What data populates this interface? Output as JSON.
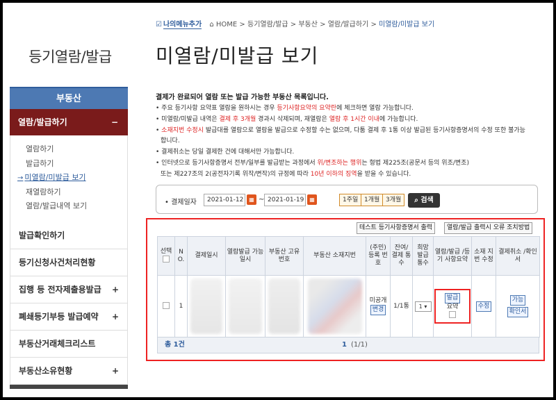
{
  "sidebar": {
    "title": "등기열람/발급",
    "section": "부동산",
    "active": "열람/발급하기",
    "sub_items": [
      "열람하기",
      "발급하기",
      "미열람/미발급 보기",
      "재열람하기",
      "열람/발급내역 보기"
    ],
    "menus": [
      {
        "label": "발급확인하기",
        "plus": false
      },
      {
        "label": "등기신청사건처리현황",
        "plus": false
      },
      {
        "label": "집행 등 전자제출용발급",
        "plus": true
      },
      {
        "label": "폐쇄등기부등 발급예약",
        "plus": true
      },
      {
        "label": "부동산거래체크리스트",
        "plus": false
      },
      {
        "label": "부동산소유현황",
        "plus": true
      }
    ]
  },
  "breadcrumb": {
    "my_menu": "나의메뉴추가",
    "items": [
      "HOME",
      "등기열람/발급",
      "부동산",
      "열람/발급하기"
    ],
    "current": "미열람/미발급 보기"
  },
  "page_title": "미열람/미발급 보기",
  "notice": {
    "heading": "결제가 완료되어 열람 또는 발급 가능한 부동산 목록입니다.",
    "l1a": "주요 등기사항 요약표 열람을 원하시는 경우 ",
    "l1r": "등기사항요약의 요약란",
    "l1b": "에 체크하면 열람 가능합니다.",
    "l2a": "미열람/미발급 내역은 ",
    "l2r": "결제 후 3개월",
    "l2b": " 경과시 삭제되며, 재열람은 ",
    "l2r2": "열람 후 1시간 이내",
    "l2c": "에 가능합니다.",
    "l3r": "소재지번 수정시",
    "l3a": " 발급대를 열람으로 열람을 발급으로 수정할 수는 없으며, 다툼 결제 후 1통 이상 발급된 등기사항증명서의 수정 또한 불가능",
    "l3b": "합니다.",
    "l4": "결제취소는 당일 결제한 건에 대해서만 가능합니다.",
    "l5a": "인터넷으로 등기사항증명서 전부/일부를 발급받는 과정에서 ",
    "l5r": "위/변조하는 행위",
    "l5b": "는 형법 제225조(공문서 등의 위조/변조)",
    "l6a": "또는 제227조의 2(공전자기록 위작/변작)의 규정에 따라 ",
    "l6r": "10년 이하의 징역",
    "l6b": "을 받을 수 있습니다."
  },
  "search": {
    "label": "결제일자",
    "from": "2021-01-12",
    "to": "2021-01-19",
    "periods": [
      "1주일",
      "1개월",
      "3개월"
    ],
    "button": "검색"
  },
  "actions": {
    "test_print": "테스트 등기사항증명서 출력",
    "error_fix": "열람/발급 출력시 오류 조치방법"
  },
  "table": {
    "headers": [
      "선택",
      "N O.",
      "결제일시",
      "열람발급 가능일시",
      "부동산 고유번호",
      "부동산 소재지번",
      "(주민) 등록 번호",
      "잔여/ 결제 통수",
      "희망 발급 통수",
      "열람/발급 /등기 사항요약",
      "소재 지번 수정",
      "결제취소 /확인서"
    ],
    "row": {
      "no": "1",
      "reg_text": "미공개",
      "reg_btn": "변경",
      "count": "1/1통",
      "select": "1",
      "issue_btn": "발급",
      "summary": "요약",
      "edit_btn": "수정",
      "cancel_status": "가능",
      "cert_btn": "확인서"
    }
  },
  "footer": {
    "total": "총 1건",
    "page": "1",
    "page_info": "(1/1)"
  }
}
